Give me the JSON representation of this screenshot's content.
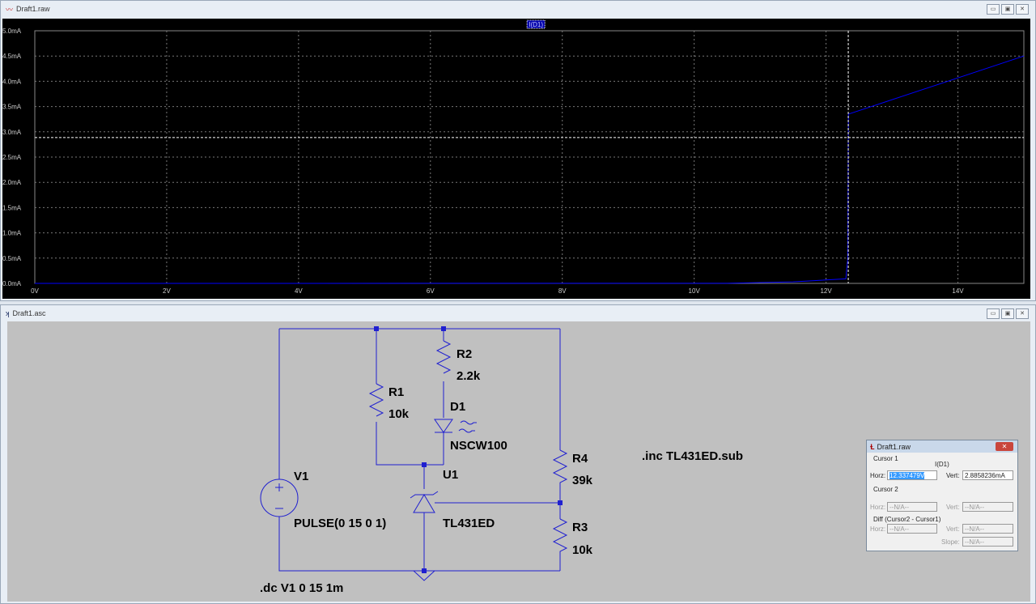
{
  "plot_window": {
    "title": "Draft1.raw",
    "trace_label": "I(D1)"
  },
  "schematic_window": {
    "title": "Draft1.asc"
  },
  "window_buttons": [
    "▭",
    "▣",
    "✕"
  ],
  "chart_data": {
    "type": "line",
    "title": "",
    "xlabel": "",
    "ylabel": "",
    "xlim": [
      0,
      15
    ],
    "ylim": [
      0,
      5
    ],
    "x_ticks": [
      "0V",
      "2V",
      "4V",
      "6V",
      "8V",
      "10V",
      "12V",
      "14V"
    ],
    "y_ticks": [
      "0.0mA",
      "0.5mA",
      "1.0mA",
      "1.5mA",
      "2.0mA",
      "2.5mA",
      "3.0mA",
      "3.5mA",
      "4.0mA",
      "4.5mA",
      "5.0mA"
    ],
    "series": [
      {
        "name": "I(D1)",
        "color": "#0000ff",
        "x": [
          0,
          10.5,
          11.5,
          12.3,
          12.33,
          12.337,
          12.34,
          15
        ],
        "y": [
          0,
          0.002,
          0.03,
          0.09,
          0.5,
          2.9,
          3.35,
          4.5
        ]
      }
    ],
    "cursor": {
      "x": 12.337,
      "y": 2.8858
    }
  },
  "schematic": {
    "R1": "R1",
    "R1v": "10k",
    "R2": "R2",
    "R2v": "2.2k",
    "D1": "D1",
    "D1v": "NSCW100",
    "U1": "U1",
    "U1v": "TL431ED",
    "R4": "R4",
    "R4v": "39k",
    "R3": "R3",
    "R3v": "10k",
    "V1": "V1",
    "V1v": "PULSE(0 15 0 1)",
    "dc": ".dc V1 0 15 1m",
    "inc": ".inc TL431ED.sub"
  },
  "cursor_dialog": {
    "title": "Draft1.raw",
    "cursor1": "Cursor 1",
    "trace": "I(D1)",
    "horz_label": "Horz:",
    "horz": "12.337479V",
    "vert_label": "Vert:",
    "vert": "2.8858236mA",
    "cursor2": "Cursor 2",
    "na": "--N/A--",
    "diff": "Diff (Cursor2 - Cursor1)",
    "slope_label": "Slope:",
    "close": "✕"
  }
}
